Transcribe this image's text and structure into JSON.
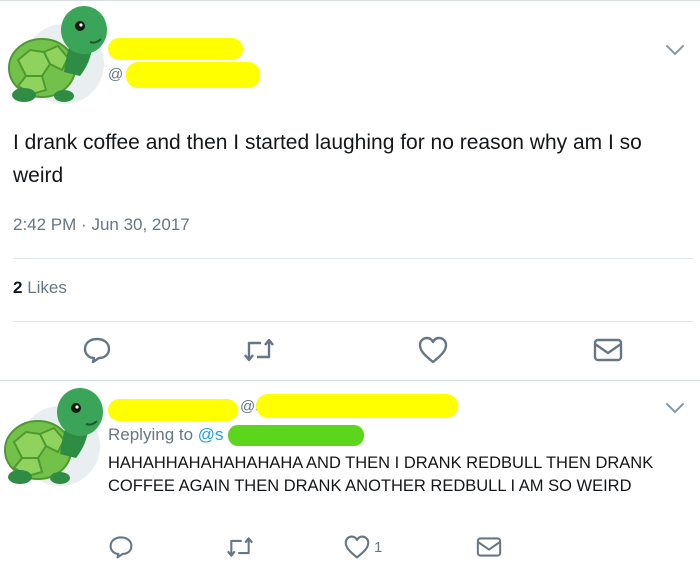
{
  "tweet": {
    "handle_prefix": "@",
    "text": "I drank coffee and then I started laughing for no reason why am I so weird",
    "time": "2:42 PM",
    "date": "Jun 30, 2017",
    "likes_count": "2",
    "likes_label": "Likes"
  },
  "reply": {
    "handle_fragment": "@s",
    "replying_label": "Replying to",
    "replying_at": "@s",
    "text": "HAHAHHAHAHAHAHAHA AND THEN I DRANK REDBULL THEN DRANK COFFEE AGAIN THEN DRANK ANOTHER REDBULL I AM SO WEIRD",
    "like_count": "1"
  },
  "colors": {
    "redaction_yellow": "#ffff00",
    "redaction_green": "#5cd61c",
    "icon_gray": "#657786",
    "link_blue": "#1da1f2"
  },
  "icons": [
    "turtle-avatar",
    "chevron-down-icon",
    "reply-icon",
    "retweet-icon",
    "heart-icon",
    "message-icon"
  ]
}
